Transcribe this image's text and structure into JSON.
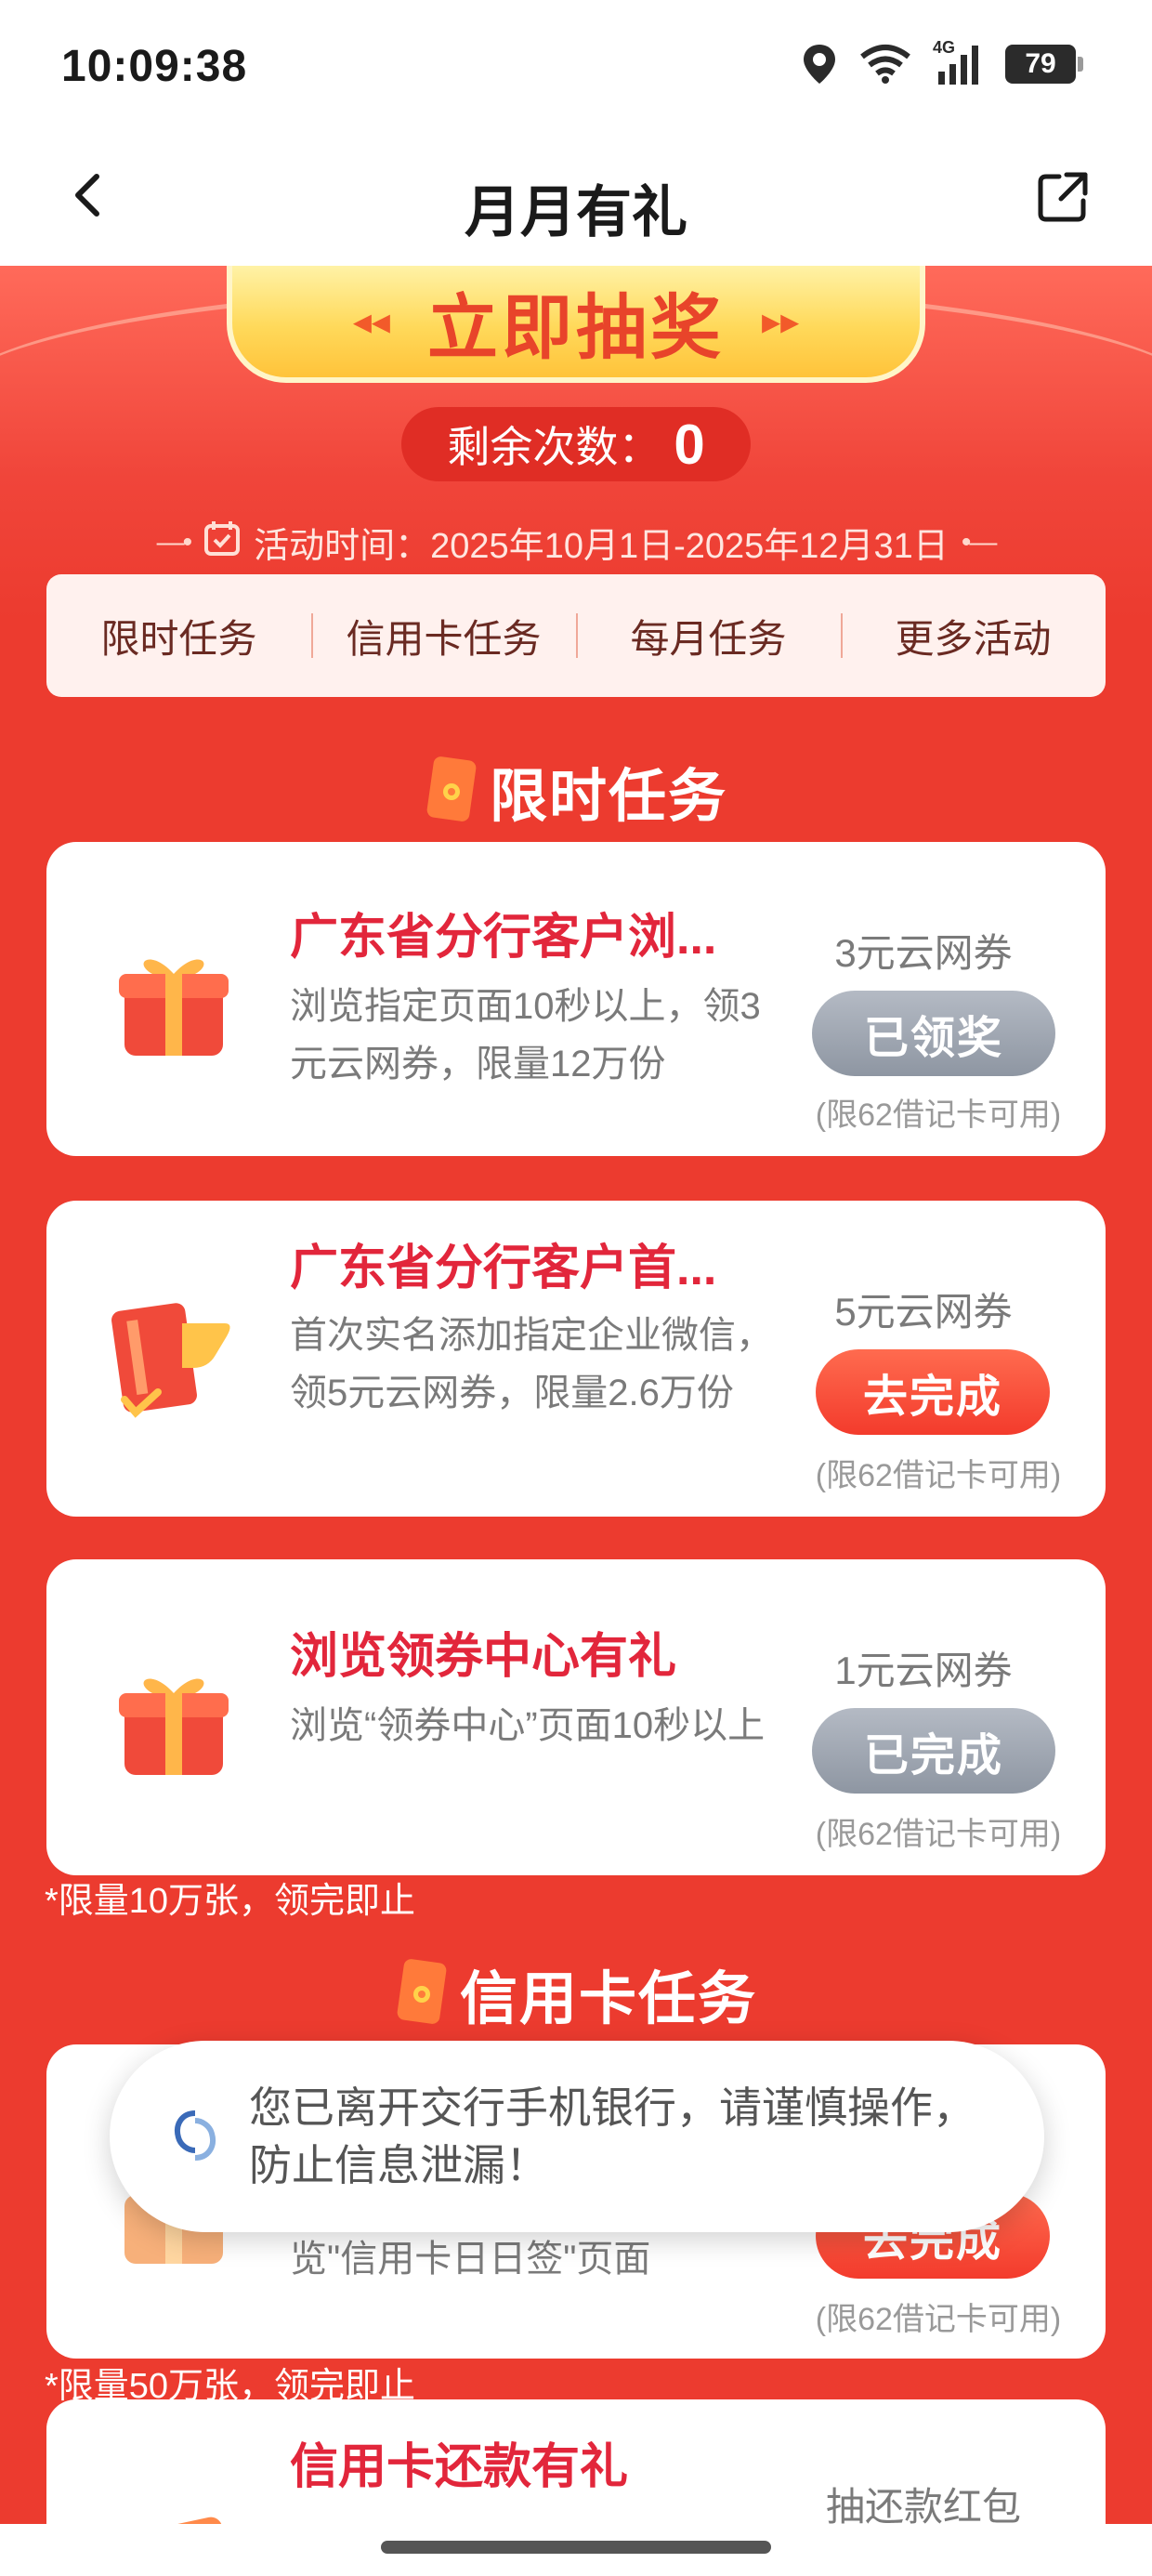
{
  "status_bar": {
    "time": "10:09:38",
    "network": "4G",
    "battery": "79",
    "icons": [
      "location-icon",
      "wifi-icon",
      "signal-icon",
      "battery-icon"
    ]
  },
  "nav": {
    "title": "月月有礼",
    "back_icon": "back-arrow-icon",
    "share_icon": "share-icon"
  },
  "banner": {
    "draw_label": "立即抽奖",
    "remaining_label": "剩余次数：",
    "remaining_count": "0",
    "period": "活动时间：2025年10月1日-2025年12月31日"
  },
  "tabs": [
    "限时任务",
    "信用卡任务",
    "每月任务",
    "更多活动"
  ],
  "sections": {
    "limited": {
      "title": "限时任务",
      "note": "*限量10万张，领完即止",
      "tasks": [
        {
          "icon": "gift-box-icon",
          "title": "广东省分行客户浏...",
          "desc": "浏览指定页面10秒以上，领3元云网券，限量12万份",
          "reward": "3元云网券",
          "button": "已领奖",
          "limit": "(限62借记卡可用)"
        },
        {
          "icon": "card-document-icon",
          "title": "广东省分行客户首...",
          "desc": "首次实名添加指定企业微信，领5元云网券，限量2.6万份",
          "reward": "5元云网券",
          "button": "去完成",
          "limit": "(限62借记卡可用)"
        },
        {
          "icon": "gift-box-icon",
          "title": "浏览领券中心有礼",
          "desc": "浏览“领券中心”页面10秒以上",
          "reward": "1元云网券",
          "button": "已完成",
          "limit": "(限62借记卡可用)"
        }
      ]
    },
    "credit": {
      "title": "信用卡任务",
      "note": "*限量50万张，领完即止",
      "tasks": [
        {
          "icon": "gift-box-icon",
          "desc_partial": "览\"信用卡日日签\"页面",
          "button_partial": "去完成",
          "limit": "(限62借记卡可用)"
        },
        {
          "icon": "credit-card-icon",
          "title": "信用卡还款有礼",
          "reward": "抽还款红包"
        }
      ]
    }
  },
  "toast": {
    "icon": "bocom-logo-icon",
    "text": "您已离开交行手机银行，请谨慎操作，防止信息泄漏！"
  },
  "colors": {
    "main_red": "#ec3b2f",
    "title_red": "#e2263b",
    "button_red": "#f33b2c",
    "button_gray": "#8e96a2",
    "gold": "#ffd95a"
  }
}
